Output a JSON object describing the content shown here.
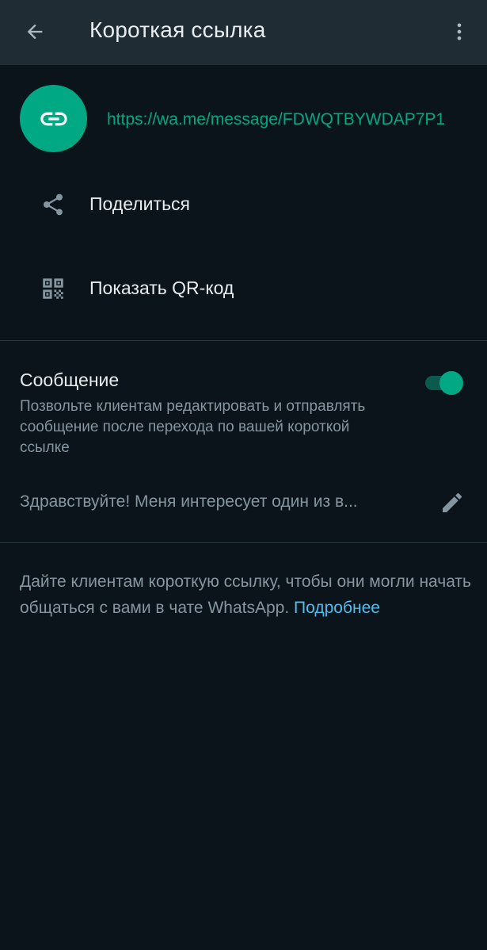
{
  "app_bar": {
    "title": "Короткая ссылка",
    "back_icon": "arrow-back-icon",
    "menu_icon": "more-vert-icon"
  },
  "link": {
    "icon": "link-icon",
    "url": "https://wa.me/message/FDWQTBYWDAP7P1"
  },
  "actions": [
    {
      "icon": "share-icon",
      "label": "Поделиться"
    },
    {
      "icon": "qr-code-icon",
      "label": "Показать QR-код"
    }
  ],
  "message_section": {
    "title": "Сообщение",
    "description": "Позвольте клиентам редактировать и отправлять сообщение после перехода по вашей короткой ссылке",
    "toggle_on": true,
    "preview_text": "Здравствуйте! Меня интересует один из в...",
    "edit_icon": "pencil-icon"
  },
  "footer": {
    "text": "Дайте клиентам короткую ссылку, чтобы они могли начать общаться с вами в чате WhatsApp.",
    "link_label": "Подробнее"
  },
  "colors": {
    "background": "#0b141a",
    "app_bar": "#1f2c34",
    "accent": "#00a884",
    "link": "#53bdeb",
    "primary_text": "#e9edef",
    "secondary_text": "#8696a0"
  }
}
